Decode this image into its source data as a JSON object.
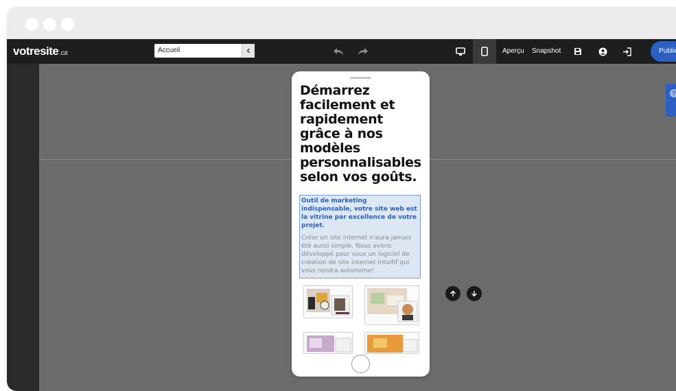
{
  "brand": {
    "name": "votresite",
    "tld": ".ca"
  },
  "toolbar": {
    "page_select_value": "Accueil",
    "preview_label": "Aperçu",
    "snapshot_label": "Snapshot",
    "publish_label": "Publier"
  },
  "phone": {
    "headline": "Démarrez facilement et rapidement grâce à nos modèles personnalisables selon vos goûts.",
    "lead": "Outil de marketing indispensable, votre site web est la vitrine par excellence de votre projet.",
    "body": "Créer un site internet n'aura jamais été aussi simple. Nous avons développé pour vous un logiciel de création de site internet intuitif qui vous rendra autonome!"
  },
  "help": {
    "label": "?"
  },
  "icons": [
    "undo-icon",
    "redo-icon",
    "desktop-icon",
    "mobile-icon",
    "save-icon",
    "user-icon",
    "exit-icon",
    "arrow-up-icon",
    "arrow-down-icon",
    "chevron-left-icon"
  ],
  "colors": {
    "accent": "#2b5fc0",
    "toolbar": "#1e1e1f",
    "canvas": "#6b6b6b",
    "selection": "#dde6f3",
    "lead_text": "#2e61b6"
  }
}
